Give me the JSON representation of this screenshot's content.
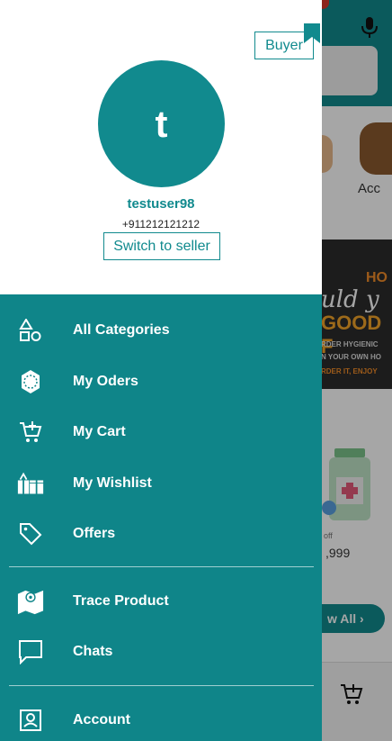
{
  "background": {
    "category_label": "Acc",
    "banner": {
      "line1": "HO",
      "line2": "uld y",
      "line3": "GOOD F",
      "line4": "RDER HYGIENIC",
      "line5": "N YOUR OWN HO",
      "line6": "RDER IT, ENJOY"
    },
    "product_off": "off",
    "product_price": ",999",
    "view_all_label": "w All"
  },
  "drawer": {
    "mode_badge": "Buyer",
    "avatar_letter": "t",
    "username": "testuser98",
    "phone": "+911212121212",
    "switch_button": "Switch to seller",
    "menu": [
      {
        "label": "All Categories",
        "icon": "shapes-icon"
      },
      {
        "label": "My Oders",
        "icon": "orders-badge-icon"
      },
      {
        "label": "My Cart",
        "icon": "cart-add-icon"
      },
      {
        "label": "My Wishlist",
        "icon": "gift-icon"
      },
      {
        "label": "Offers",
        "icon": "tag-icon"
      },
      {
        "label": "Trace Product",
        "icon": "map-icon"
      },
      {
        "label": "Chats",
        "icon": "chat-icon"
      },
      {
        "label": "Account",
        "icon": "account-icon"
      }
    ]
  },
  "colors": {
    "primary": "#118a8e",
    "menu_bg": "#0f8589",
    "text_white": "#ffffff"
  }
}
